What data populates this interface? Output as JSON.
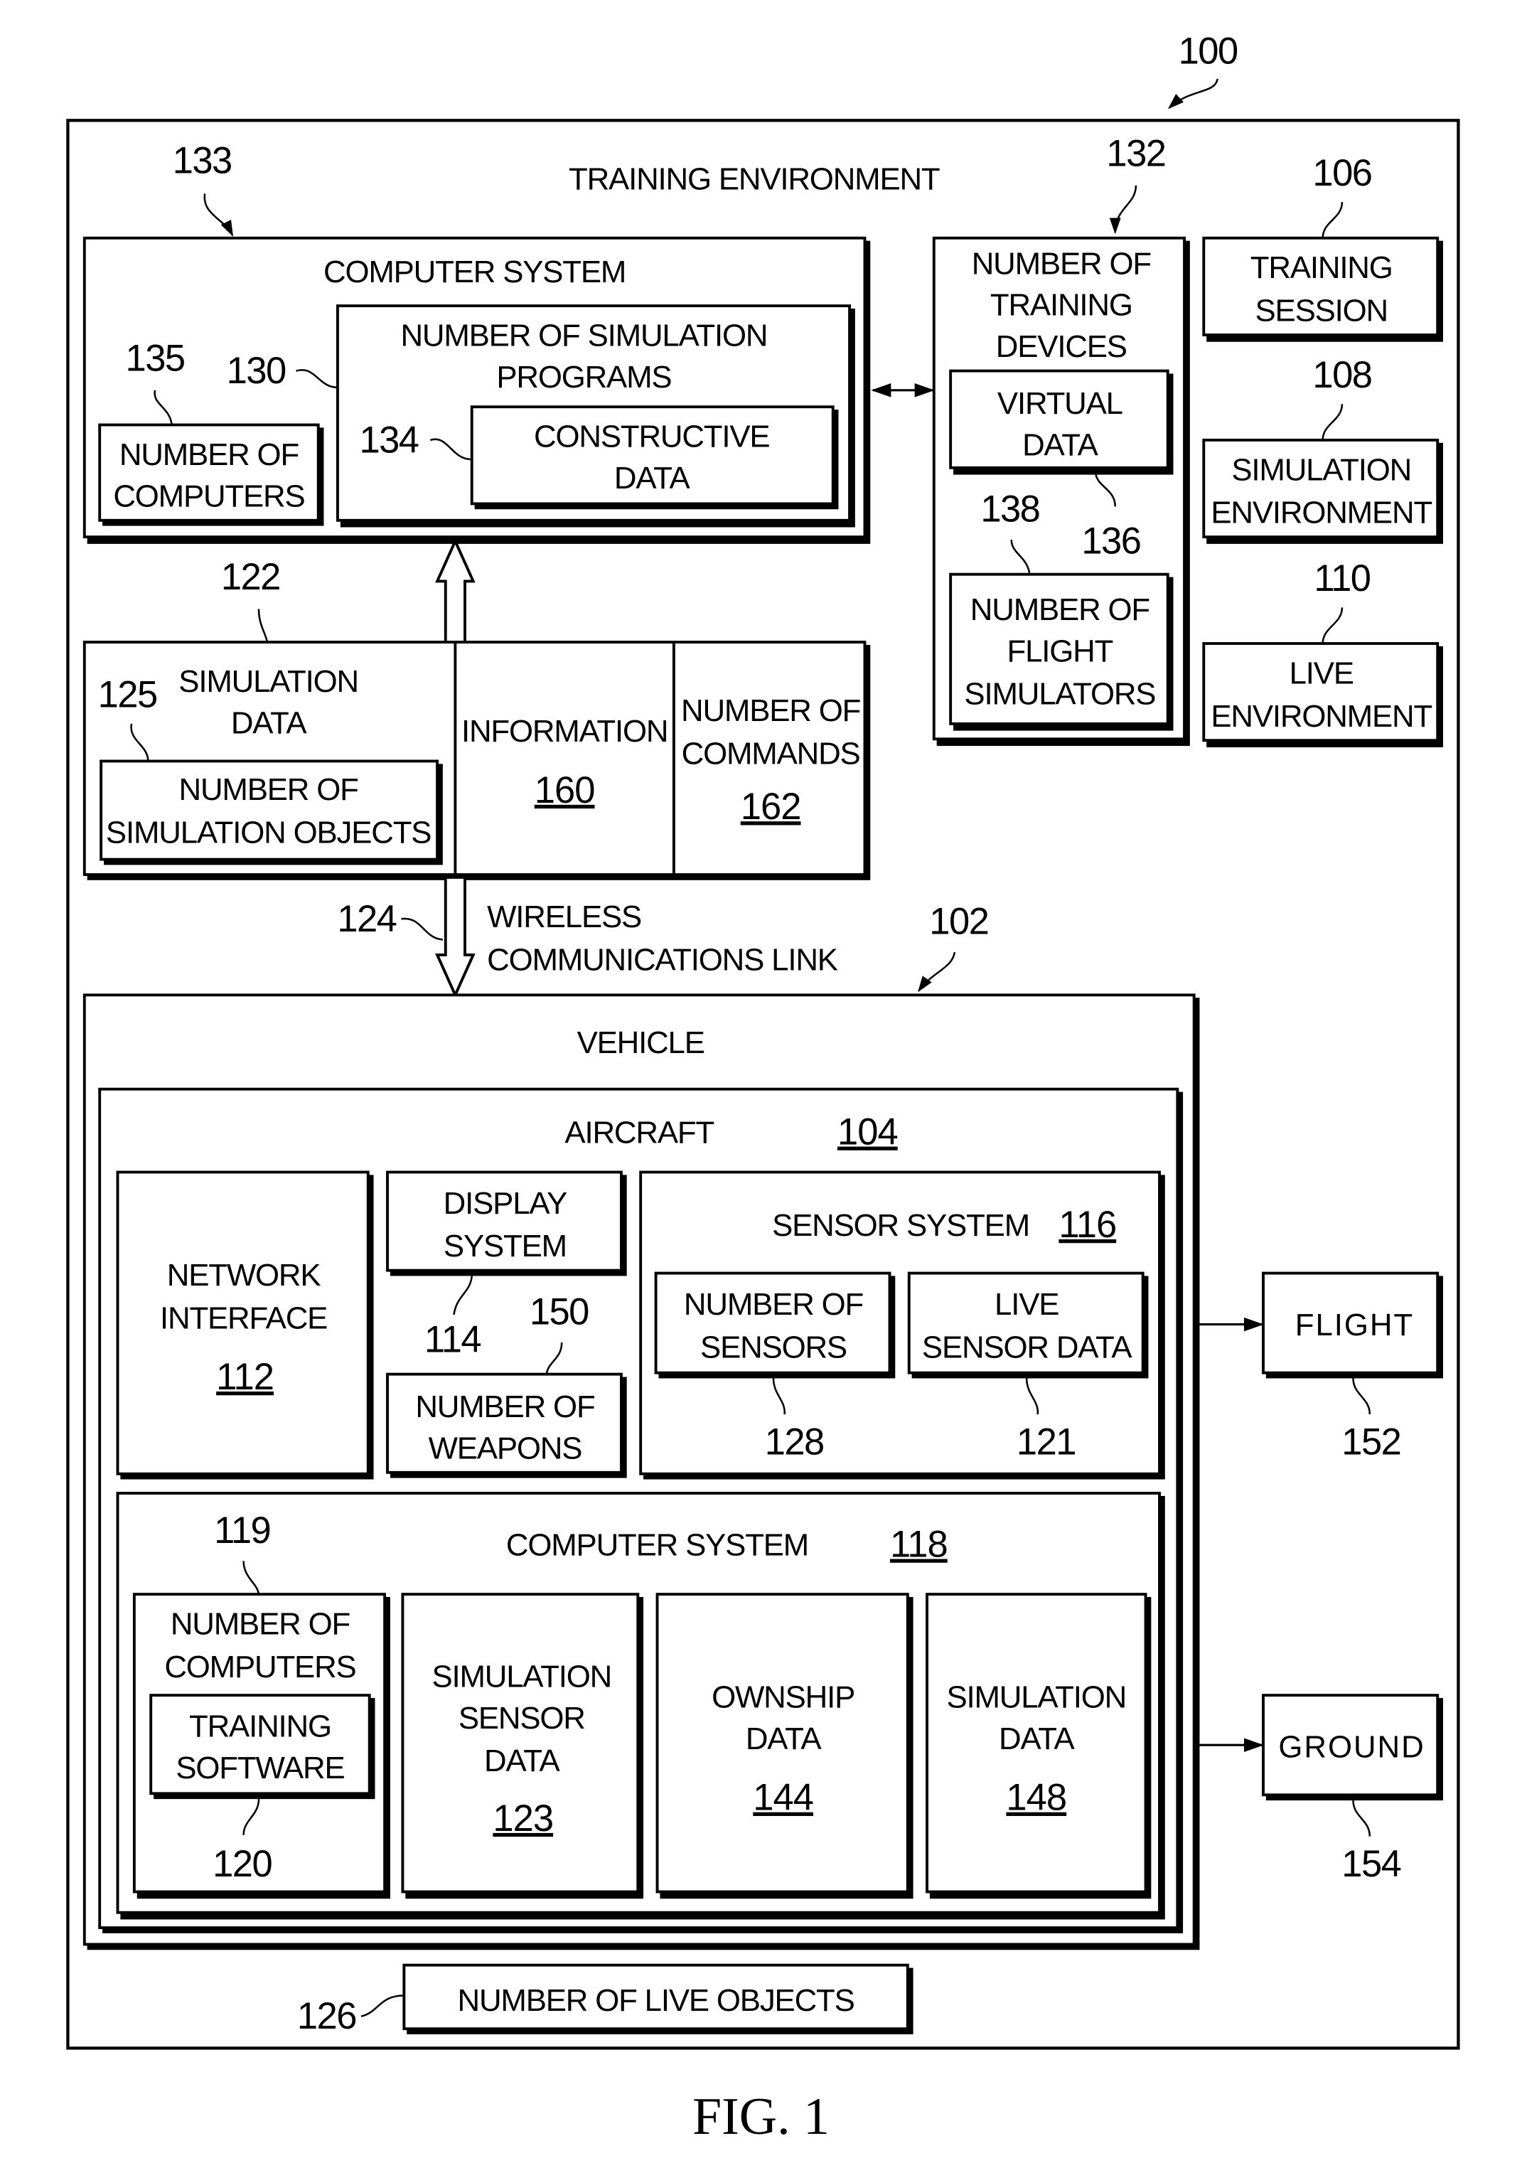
{
  "figure": {
    "caption": "FIG. 1",
    "ref_system": "100",
    "training_environment": {
      "label": "TRAINING ENVIRONMENT"
    },
    "computer_system_top": {
      "ref": "133",
      "label": "COMPUTER SYSTEM",
      "number_of_computers": {
        "ref": "135",
        "line1": "NUMBER OF",
        "line2": "COMPUTERS"
      },
      "simulation_programs": {
        "ref": "130",
        "line1": "NUMBER OF SIMULATION",
        "line2": "PROGRAMS"
      },
      "constructive_data": {
        "ref": "134",
        "line1": "CONSTRUCTIVE",
        "line2": "DATA"
      }
    },
    "training_devices": {
      "ref": "132",
      "line1": "NUMBER OF",
      "line2": "TRAINING",
      "line3": "DEVICES",
      "virtual_data": {
        "ref": "136",
        "line1": "VIRTUAL",
        "line2": "DATA"
      },
      "flight_simulators": {
        "ref": "138",
        "line1": "NUMBER OF",
        "line2": "FLIGHT",
        "line3": "SIMULATORS"
      }
    },
    "training_session": {
      "ref": "106",
      "line1": "TRAINING",
      "line2": "SESSION"
    },
    "simulation_environment": {
      "ref": "108",
      "line1": "SIMULATION",
      "line2": "ENVIRONMENT"
    },
    "live_environment": {
      "ref": "110",
      "line1": "LIVE",
      "line2": "ENVIRONMENT"
    },
    "simulation_data_block": {
      "ref": "122",
      "line1": "SIMULATION",
      "line2": "DATA",
      "simulation_objects": {
        "ref": "125",
        "line1": "NUMBER OF",
        "line2": "SIMULATION OBJECTS"
      },
      "information": {
        "label": "INFORMATION",
        "ref": "160"
      },
      "commands": {
        "line1": "NUMBER OF",
        "line2": "COMMANDS",
        "ref": "162"
      }
    },
    "wireless_link": {
      "ref": "124",
      "line1": "WIRELESS",
      "line2": "COMMUNICATIONS LINK"
    },
    "vehicle": {
      "ref": "102",
      "label": "VEHICLE",
      "aircraft": {
        "label": "AIRCRAFT",
        "ref": "104",
        "network_interface": {
          "line1": "NETWORK",
          "line2": "INTERFACE",
          "ref": "112"
        },
        "display_system": {
          "line1": "DISPLAY",
          "line2": "SYSTEM",
          "ref": "114"
        },
        "weapons": {
          "line1": "NUMBER OF",
          "line2": "WEAPONS",
          "ref": "150"
        },
        "sensor_system": {
          "label": "SENSOR SYSTEM",
          "ref": "116",
          "number_of_sensors": {
            "line1": "NUMBER OF",
            "line2": "SENSORS",
            "ref": "128"
          },
          "live_sensor_data": {
            "line1": "LIVE",
            "line2": "SENSOR DATA",
            "ref": "121"
          }
        },
        "computer_system": {
          "label": "COMPUTER SYSTEM",
          "ref": "118",
          "number_of_computers": {
            "line1": "NUMBER OF",
            "line2": "COMPUTERS",
            "ref": "119"
          },
          "training_software": {
            "line1": "TRAINING",
            "line2": "SOFTWARE",
            "ref": "120"
          },
          "simulation_sensor_data": {
            "line1": "SIMULATION",
            "line2": "SENSOR",
            "line3": "DATA",
            "ref": "123"
          },
          "ownship_data": {
            "line1": "OWNSHIP",
            "line2": "DATA",
            "ref": "144"
          },
          "simulation_data": {
            "line1": "SIMULATION",
            "line2": "DATA",
            "ref": "148"
          }
        }
      }
    },
    "flight": {
      "label": "FLIGHT",
      "ref": "152"
    },
    "ground": {
      "label": "GROUND",
      "ref": "154"
    },
    "live_objects": {
      "label": "NUMBER OF LIVE OBJECTS",
      "ref": "126"
    }
  }
}
